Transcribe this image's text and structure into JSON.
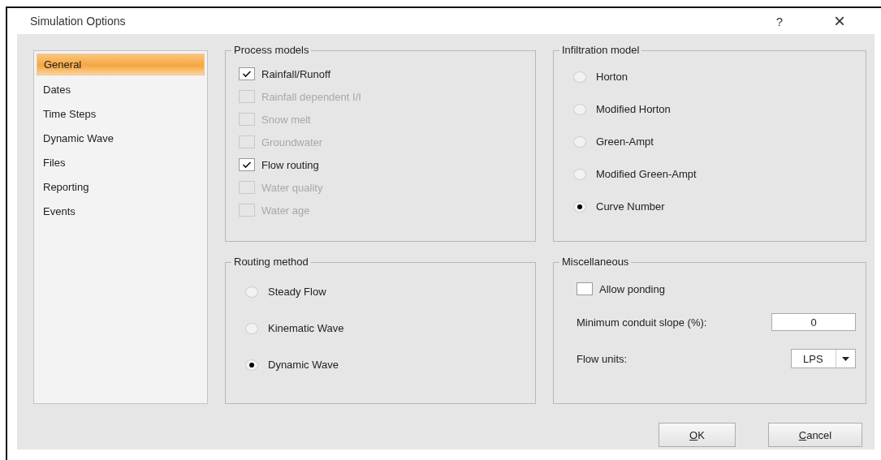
{
  "window": {
    "title": "Simulation Options",
    "help": "?",
    "close": "×"
  },
  "sidebar": {
    "items": [
      {
        "label": "General",
        "selected": true
      },
      {
        "label": "Dates",
        "selected": false
      },
      {
        "label": "Time Steps",
        "selected": false
      },
      {
        "label": "Dynamic Wave",
        "selected": false
      },
      {
        "label": "Files",
        "selected": false
      },
      {
        "label": "Reporting",
        "selected": false
      },
      {
        "label": "Events",
        "selected": false
      }
    ]
  },
  "process_models": {
    "title": "Process models",
    "items": [
      {
        "label": "Rainfall/Runoff",
        "checked": true,
        "disabled": false
      },
      {
        "label": "Rainfall dependent I/I",
        "checked": false,
        "disabled": true
      },
      {
        "label": "Snow melt",
        "checked": false,
        "disabled": true
      },
      {
        "label": "Groundwater",
        "checked": false,
        "disabled": true
      },
      {
        "label": "Flow routing",
        "checked": true,
        "disabled": false
      },
      {
        "label": "Water quality",
        "checked": false,
        "disabled": true
      },
      {
        "label": "Water age",
        "checked": false,
        "disabled": true
      }
    ]
  },
  "infiltration_model": {
    "title": "Infiltration model",
    "options": [
      {
        "label": "Horton",
        "selected": false
      },
      {
        "label": "Modified Horton",
        "selected": false
      },
      {
        "label": "Green-Ampt",
        "selected": false
      },
      {
        "label": "Modified Green-Ampt",
        "selected": false
      },
      {
        "label": "Curve Number",
        "selected": true
      }
    ]
  },
  "routing_method": {
    "title": "Routing method",
    "options": [
      {
        "label": "Steady Flow",
        "selected": false
      },
      {
        "label": "Kinematic Wave",
        "selected": false
      },
      {
        "label": "Dynamic Wave",
        "selected": true
      }
    ]
  },
  "miscellaneous": {
    "title": "Miscellaneous",
    "allow_ponding": {
      "label": "Allow ponding",
      "checked": false
    },
    "min_conduit_slope": {
      "label": "Minimum conduit slope (%):",
      "value": "0"
    },
    "flow_units": {
      "label": "Flow units:",
      "value": "LPS"
    }
  },
  "buttons": [
    {
      "label": "OK"
    },
    {
      "label": "Cancel"
    }
  ]
}
